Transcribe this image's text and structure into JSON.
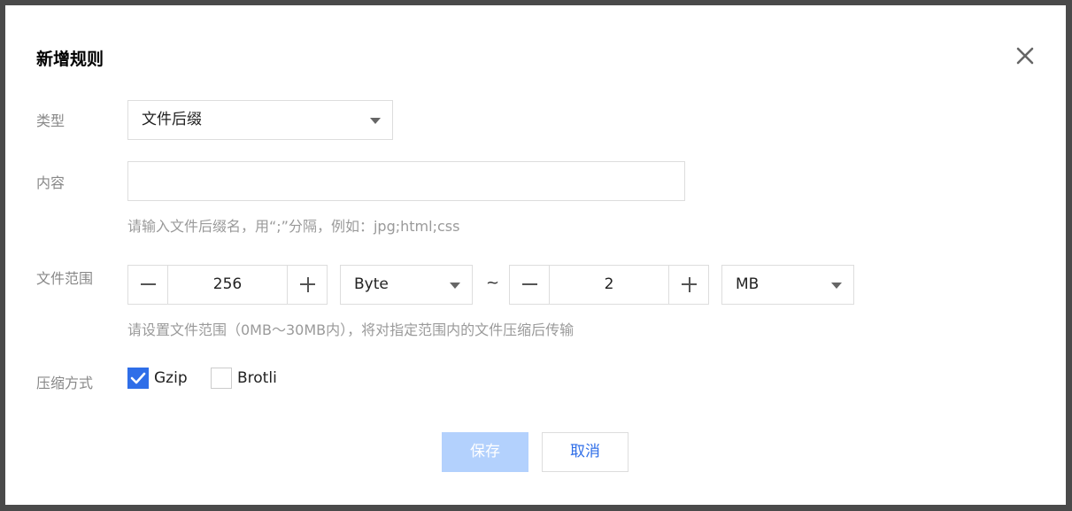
{
  "dialog": {
    "title": "新增规则"
  },
  "type_field": {
    "label": "类型",
    "selected": "文件后缀"
  },
  "content_field": {
    "label": "内容",
    "value": "",
    "hint": "请输入文件后缀名，用“;”分隔，例如：jpg;html;css"
  },
  "size_range": {
    "label": "文件范围",
    "min_value": "256",
    "min_unit": "Byte",
    "separator": "~",
    "max_value": "2",
    "max_unit": "MB",
    "hint": "请设置文件范围（0MB～30MB内），将对指定范围内的文件压缩后传输"
  },
  "compression": {
    "label": "压缩方式",
    "options": [
      {
        "label": "Gzip",
        "checked": true
      },
      {
        "label": "Brotli",
        "checked": false
      }
    ]
  },
  "actions": {
    "save": "保存",
    "cancel": "取消"
  },
  "colors": {
    "accent": "#2f6ee8",
    "save_disabled_bg": "#b3d1fd",
    "backdrop": "#4a4a4a"
  },
  "icons": {
    "close": "close-icon",
    "caret": "chevron-down-icon",
    "minus": "minus-icon",
    "plus": "plus-icon",
    "check": "checkmark-icon"
  }
}
